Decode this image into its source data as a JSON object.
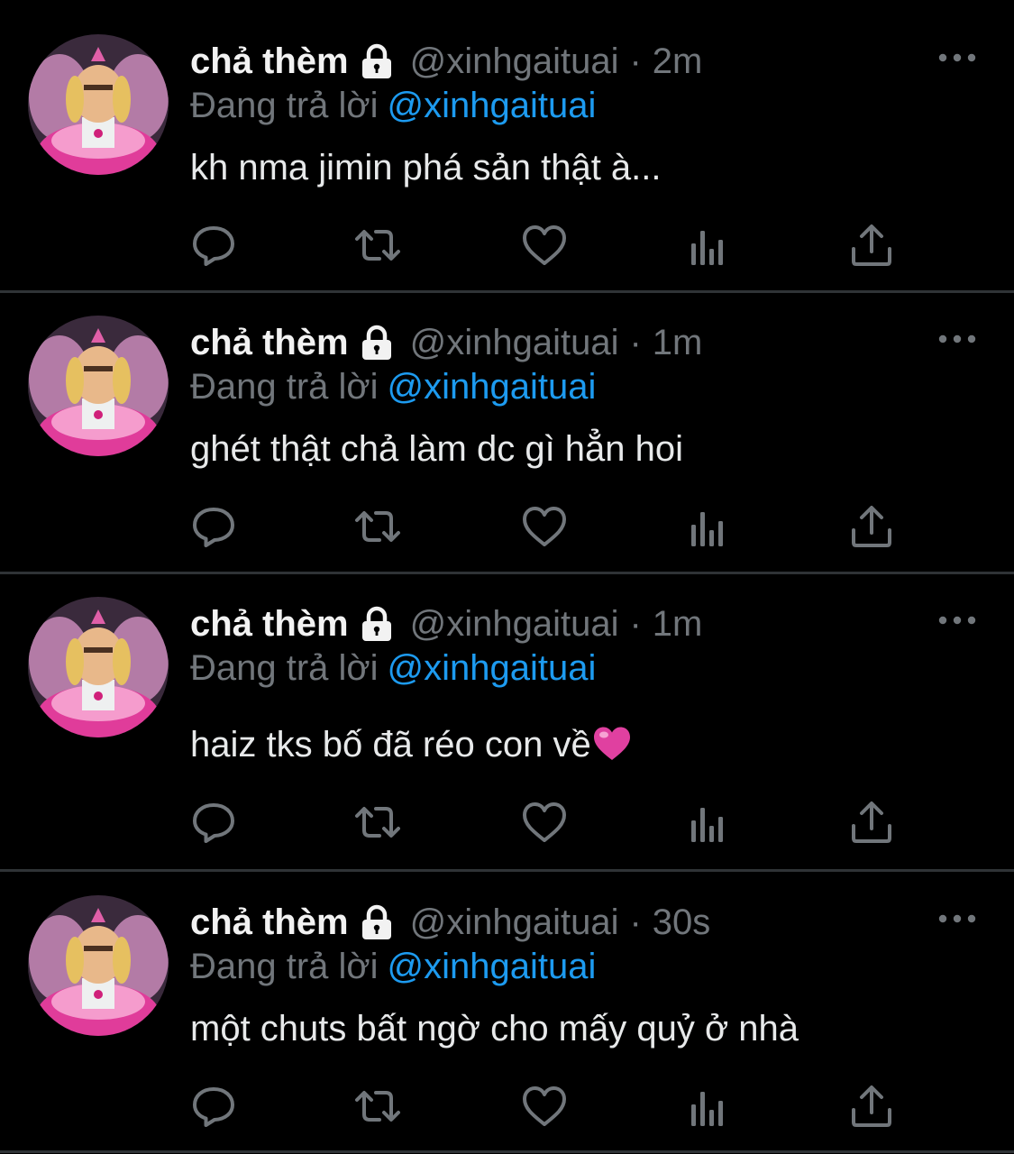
{
  "colors": {
    "background": "#000000",
    "name": "#f2f2f2",
    "muted": "#71767b",
    "mention": "#1d9bf0",
    "divider": "#2f3336",
    "heart_emoji": "#e040a0"
  },
  "tweets": [
    {
      "display_name": "chả thèm",
      "protected_icon": "lock-icon",
      "handle": "@xinhgaituai",
      "separator": "·",
      "time": "2m",
      "reply_prefix": "Đang trả lời",
      "reply_to": "@xinhgaituai",
      "text": "kh nma jimin phá sản thật à...",
      "emoji": ""
    },
    {
      "display_name": "chả thèm",
      "protected_icon": "lock-icon",
      "handle": "@xinhgaituai",
      "separator": "·",
      "time": "1m",
      "reply_prefix": "Đang trả lời",
      "reply_to": "@xinhgaituai",
      "text": "ghét thật chả làm dc gì hẳn hoi",
      "emoji": ""
    },
    {
      "display_name": "chả thèm",
      "protected_icon": "lock-icon",
      "handle": "@xinhgaituai",
      "separator": "·",
      "time": "1m",
      "reply_prefix": "Đang trả lời",
      "reply_to": "@xinhgaituai",
      "text": "haiz tks bố đã réo con về",
      "emoji": "pink-heart-emoji"
    },
    {
      "display_name": "chả thèm",
      "protected_icon": "lock-icon",
      "handle": "@xinhgaituai",
      "separator": "·",
      "time": "30s",
      "reply_prefix": "Đang trả lời",
      "reply_to": "@xinhgaituai",
      "text": "một chuts bất ngờ cho mấy quỷ ở nhà",
      "emoji": ""
    }
  ],
  "action_icons": [
    "reply-icon",
    "retweet-icon",
    "like-icon",
    "views-icon",
    "share-icon"
  ],
  "menu_icon": "more-options-icon"
}
